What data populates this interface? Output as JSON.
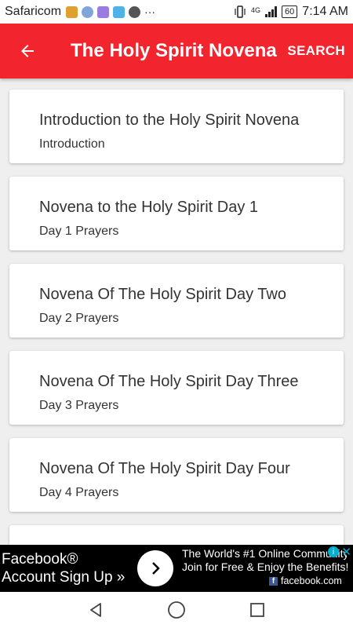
{
  "status_bar": {
    "carrier": "Safaricom",
    "more": "···",
    "network": "4G",
    "battery": "60",
    "time": "7:14 AM"
  },
  "app_bar": {
    "title": "The Holy Spirit Novena",
    "search_label": "SEARCH",
    "color": "#f2252f"
  },
  "items": [
    {
      "title": "Introduction to the Holy Spirit Novena",
      "subtitle": "Introduction"
    },
    {
      "title": "Novena to the Holy Spirit Day 1",
      "subtitle": "Day 1 Prayers"
    },
    {
      "title": "Novena Of The Holy Spirit Day Two",
      "subtitle": "Day 2 Prayers"
    },
    {
      "title": "Novena Of The Holy Spirit Day Three",
      "subtitle": "Day 3 Prayers"
    },
    {
      "title": "Novena Of The Holy Spirit Day Four",
      "subtitle": "Day 4 Prayers"
    },
    {
      "title": "",
      "subtitle": ""
    }
  ],
  "ad": {
    "left_line1": "Facebook®",
    "left_line2": "Account Sign Up »",
    "right_line1": "The World's #1 Online Community",
    "right_line2": "Join for Free & Enjoy the Benefits!",
    "domain": "facebook.com",
    "info": "i",
    "close": "✕"
  },
  "icons": {
    "back": "back-arrow-icon",
    "nav_back": "triangle-back-icon",
    "nav_home": "circle-home-icon",
    "nav_recents": "square-recents-icon"
  }
}
